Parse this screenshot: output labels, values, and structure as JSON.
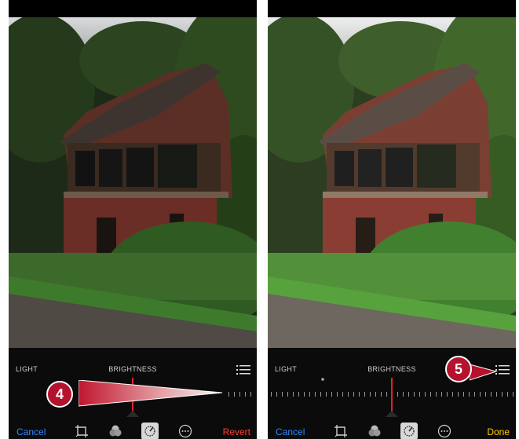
{
  "left_screen": {
    "mode_label": "LIGHT",
    "adjustment_label": "BRIGHTNESS",
    "cancel_label": "Cancel",
    "action_label": "Revert",
    "action_color": "#ff3b30",
    "tools": [
      "crop-icon",
      "filters-icon",
      "adjust-icon",
      "more-icon"
    ]
  },
  "right_screen": {
    "mode_label": "LIGHT",
    "adjustment_label": "BRIGHTNESS",
    "cancel_label": "Cancel",
    "action_label": "Done",
    "action_color": "#ffcc00",
    "tools": [
      "crop-icon",
      "filters-icon",
      "adjust-icon",
      "more-icon"
    ]
  },
  "callouts": [
    "4",
    "5"
  ],
  "colors": {
    "accent_blue": "#2f86ff",
    "callout_red": "#b5122e",
    "slider_red": "#e0242c"
  }
}
